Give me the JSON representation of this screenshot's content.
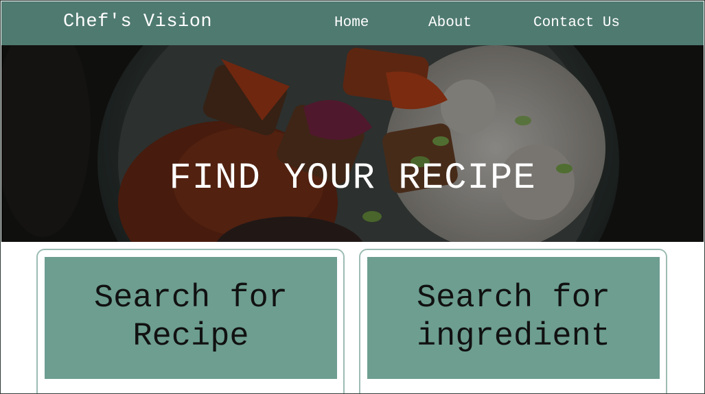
{
  "header": {
    "brand": "Chef's Vision",
    "nav": [
      {
        "label": "Home"
      },
      {
        "label": "About"
      },
      {
        "label": "Contact Us"
      }
    ]
  },
  "hero": {
    "title": "FIND YOUR RECIPE",
    "image": "kebab-and-rice-bowl"
  },
  "cards": [
    {
      "label": "Search for Recipe"
    },
    {
      "label": "Search for ingredient"
    }
  ],
  "colors": {
    "header_bg": "#4f7a70",
    "card_button": "#6d9e90",
    "card_border": "#9bbcb3",
    "hero_text": "#ffffff"
  }
}
